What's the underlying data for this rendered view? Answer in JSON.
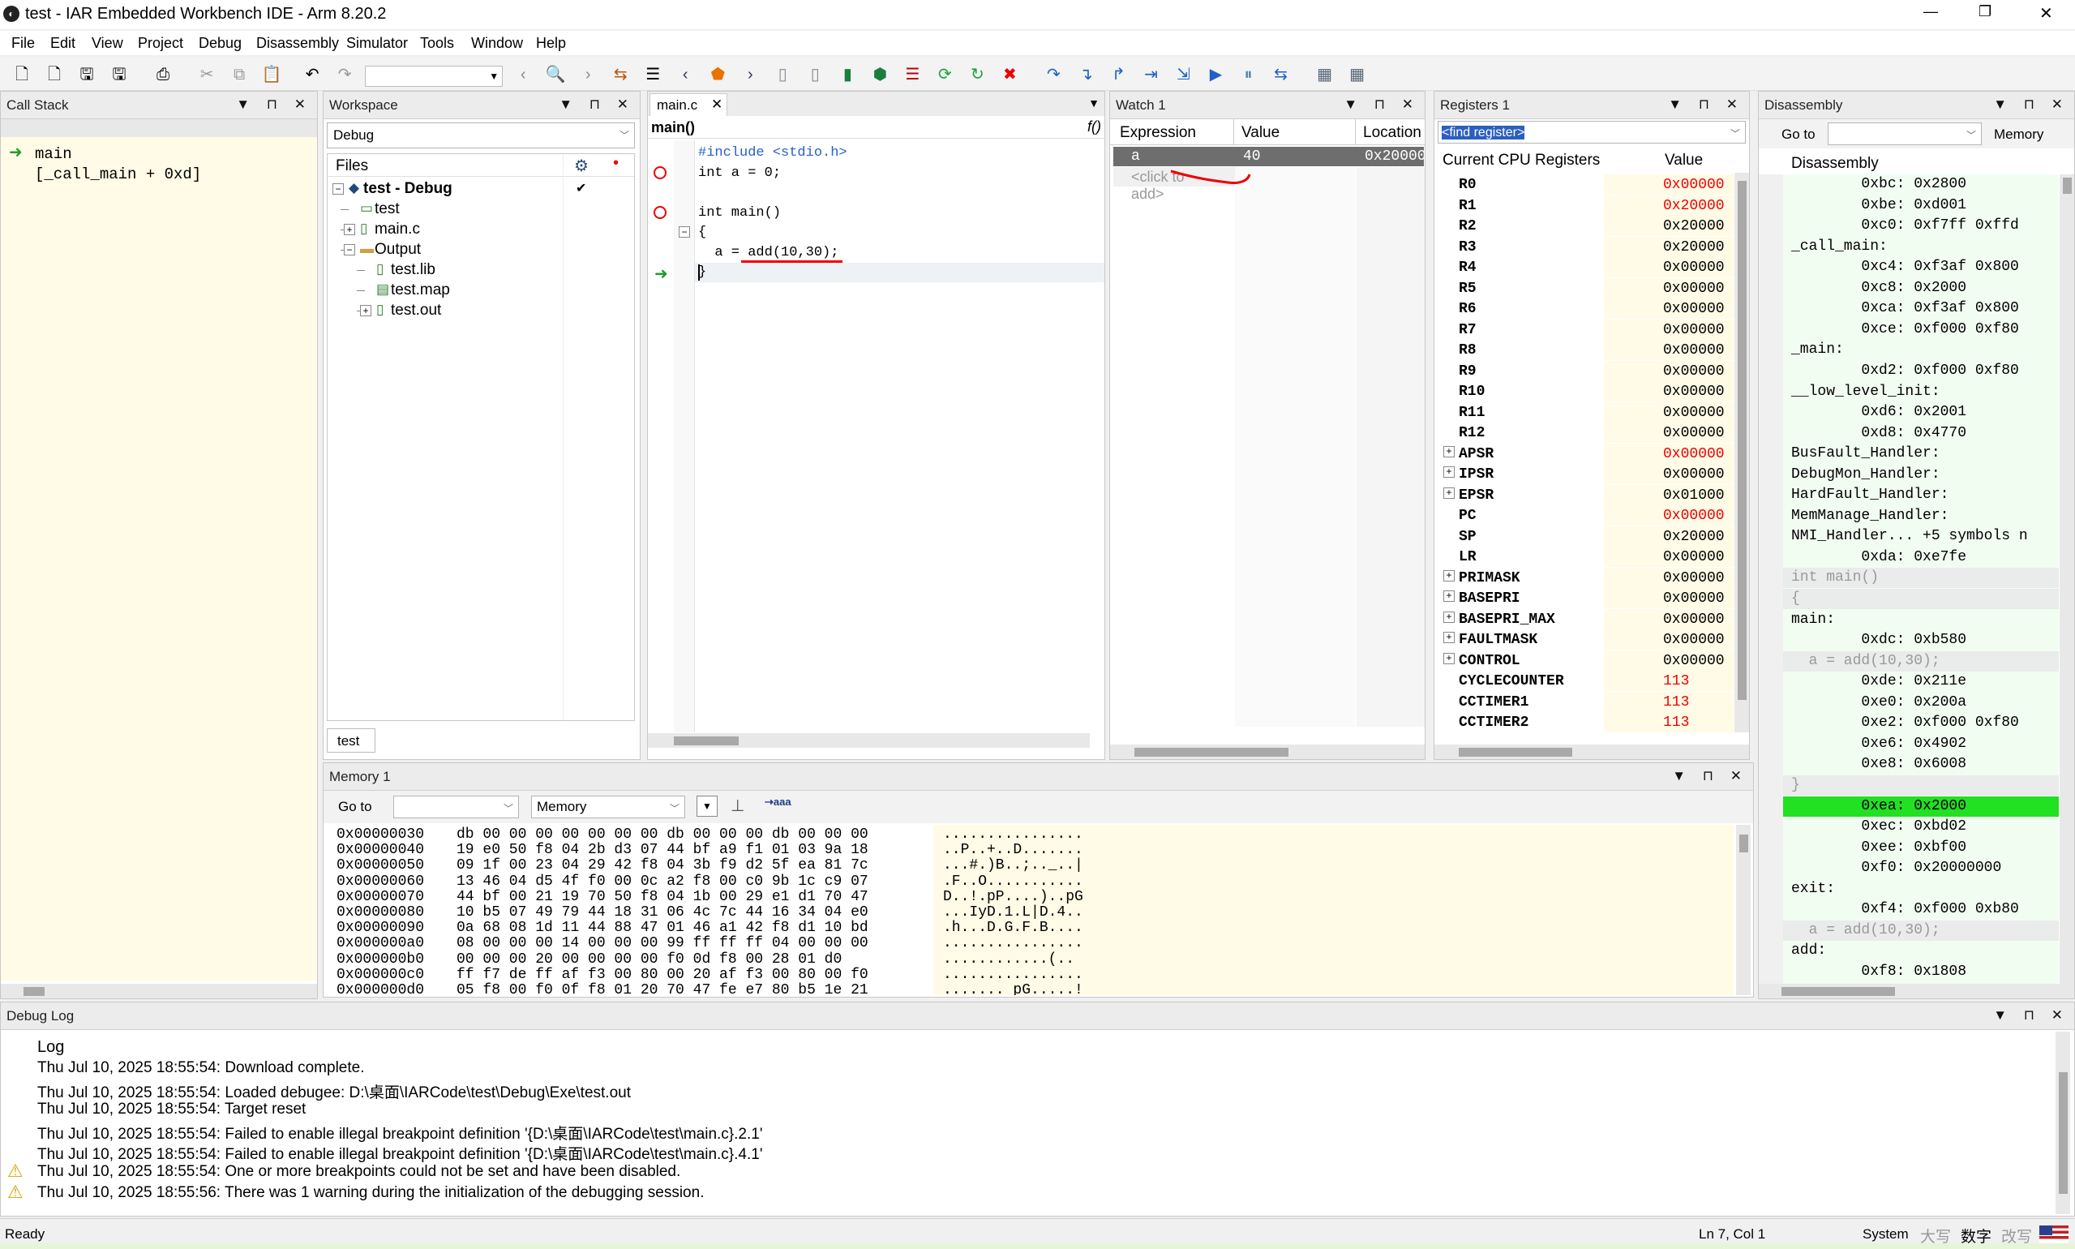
{
  "window": {
    "title": "test - IAR Embedded Workbench IDE - Arm 8.20.2",
    "controls": {
      "minimize": "—",
      "maximize": "❐",
      "close": "✕"
    }
  },
  "menu": [
    "File",
    "Edit",
    "View",
    "Project",
    "Debug",
    "Disassembly",
    "Simulator",
    "Tools",
    "Window",
    "Help"
  ],
  "callstack": {
    "title": "Call Stack",
    "frames": [
      "main",
      "[_call_main + 0xd]"
    ]
  },
  "workspace": {
    "title": "Workspace",
    "config": "Debug",
    "files_header": "Files",
    "tree": [
      {
        "label": "test - Debug",
        "level": 0,
        "expand": "−",
        "icon": "◆",
        "check": "✔"
      },
      {
        "label": "test",
        "level": 1,
        "expand": "",
        "icon": "▭"
      },
      {
        "label": "main.c",
        "level": 1,
        "expand": "+",
        "icon": "▯"
      },
      {
        "label": "Output",
        "level": 1,
        "expand": "−",
        "icon": "▬"
      },
      {
        "label": "test.lib",
        "level": 2,
        "expand": "",
        "icon": "▯"
      },
      {
        "label": "test.map",
        "level": 2,
        "expand": "",
        "icon": "▤"
      },
      {
        "label": "test.out",
        "level": 2,
        "expand": "+",
        "icon": "▯"
      }
    ],
    "tab": "test"
  },
  "editor": {
    "tab": "main.c",
    "function": "main()",
    "fbutton": "f()",
    "lines": [
      {
        "code": "#include <stdio.h>",
        "bp": false
      },
      {
        "code": "int a = 0;",
        "bp": true
      },
      {
        "code": "",
        "bp": false
      },
      {
        "code": "int main()",
        "bp": true
      },
      {
        "code": "{",
        "bp": false
      },
      {
        "code": "  a = add(10,30);",
        "bp": false
      },
      {
        "code": "}",
        "bp": false
      }
    ]
  },
  "watch": {
    "title": "Watch 1",
    "columns": [
      "Expression",
      "Value",
      "Location"
    ],
    "rows": [
      {
        "expr": "a",
        "value": "40",
        "loc": "0x20000"
      }
    ],
    "placeholder": "<click to add>"
  },
  "registers": {
    "title": "Registers 1",
    "find": "<find register>",
    "group_header": "Current CPU Registers",
    "value_header": "Value",
    "regs": [
      {
        "name": "R0",
        "value": "0x00000",
        "red": true,
        "expand": false
      },
      {
        "name": "R1",
        "value": "0x20000",
        "red": true,
        "expand": false
      },
      {
        "name": "R2",
        "value": "0x20000",
        "red": false,
        "expand": false
      },
      {
        "name": "R3",
        "value": "0x20000",
        "red": false,
        "expand": false
      },
      {
        "name": "R4",
        "value": "0x00000",
        "red": false,
        "expand": false
      },
      {
        "name": "R5",
        "value": "0x00000",
        "red": false,
        "expand": false
      },
      {
        "name": "R6",
        "value": "0x00000",
        "red": false,
        "expand": false
      },
      {
        "name": "R7",
        "value": "0x00000",
        "red": false,
        "expand": false
      },
      {
        "name": "R8",
        "value": "0x00000",
        "red": false,
        "expand": false
      },
      {
        "name": "R9",
        "value": "0x00000",
        "red": false,
        "expand": false
      },
      {
        "name": "R10",
        "value": "0x00000",
        "red": false,
        "expand": false
      },
      {
        "name": "R11",
        "value": "0x00000",
        "red": false,
        "expand": false
      },
      {
        "name": "R12",
        "value": "0x00000",
        "red": false,
        "expand": false
      },
      {
        "name": "APSR",
        "value": "0x00000",
        "red": true,
        "expand": true
      },
      {
        "name": "IPSR",
        "value": "0x00000",
        "red": false,
        "expand": true
      },
      {
        "name": "EPSR",
        "value": "0x01000",
        "red": false,
        "expand": true
      },
      {
        "name": "PC",
        "value": "0x00000",
        "red": true,
        "expand": false
      },
      {
        "name": "SP",
        "value": "0x20000",
        "red": false,
        "expand": false
      },
      {
        "name": "LR",
        "value": "0x00000",
        "red": false,
        "expand": false
      },
      {
        "name": "PRIMASK",
        "value": "0x00000",
        "red": false,
        "expand": true
      },
      {
        "name": "BASEPRI",
        "value": "0x00000",
        "red": false,
        "expand": true
      },
      {
        "name": "BASEPRI_MAX",
        "value": "0x00000",
        "red": false,
        "expand": true
      },
      {
        "name": "FAULTMASK",
        "value": "0x00000",
        "red": false,
        "expand": true
      },
      {
        "name": "CONTROL",
        "value": "0x00000",
        "red": false,
        "expand": true
      },
      {
        "name": "CYCLECOUNTER",
        "value": "113",
        "red": true,
        "expand": false
      },
      {
        "name": "CCTIMER1",
        "value": "113",
        "red": true,
        "expand": false
      },
      {
        "name": "CCTIMER2",
        "value": "113",
        "red": true,
        "expand": false
      }
    ]
  },
  "disasm": {
    "title": "Disassembly",
    "goto": "Go to",
    "memory": "Memory",
    "header": "Disassembly",
    "lines": [
      {
        "t": "        0xbc: 0x2800",
        "k": "code"
      },
      {
        "t": "        0xbe: 0xd001",
        "k": "code"
      },
      {
        "t": "        0xc0: 0xf7ff 0xffd",
        "k": "code"
      },
      {
        "t": "_call_main:",
        "k": "label"
      },
      {
        "t": "        0xc4: 0xf3af 0x800",
        "k": "code"
      },
      {
        "t": "        0xc8: 0x2000",
        "k": "code"
      },
      {
        "t": "        0xca: 0xf3af 0x800",
        "k": "code"
      },
      {
        "t": "        0xce: 0xf000 0xf80",
        "k": "code"
      },
      {
        "t": "_main:",
        "k": "label"
      },
      {
        "t": "        0xd2: 0xf000 0xf80",
        "k": "code"
      },
      {
        "t": "__low_level_init:",
        "k": "label"
      },
      {
        "t": "        0xd6: 0x2001",
        "k": "code"
      },
      {
        "t": "        0xd8: 0x4770",
        "k": "code"
      },
      {
        "t": "BusFault_Handler:",
        "k": "label"
      },
      {
        "t": "DebugMon_Handler:",
        "k": "label"
      },
      {
        "t": "HardFault_Handler:",
        "k": "label"
      },
      {
        "t": "MemManage_Handler:",
        "k": "label"
      },
      {
        "t": "NMI_Handler... +5 symbols n",
        "k": "label"
      },
      {
        "t": "        0xda: 0xe7fe",
        "k": "code"
      },
      {
        "t": "int main()",
        "k": "src"
      },
      {
        "t": "{",
        "k": "src"
      },
      {
        "t": "main:",
        "k": "label"
      },
      {
        "t": "        0xdc: 0xb580",
        "k": "code"
      },
      {
        "t": "  a = add(10,30);",
        "k": "src"
      },
      {
        "t": "        0xde: 0x211e",
        "k": "code"
      },
      {
        "t": "        0xe0: 0x200a",
        "k": "code"
      },
      {
        "t": "        0xe2: 0xf000 0xf80",
        "k": "code"
      },
      {
        "t": "        0xe6: 0x4902",
        "k": "code"
      },
      {
        "t": "        0xe8: 0x6008",
        "k": "code"
      },
      {
        "t": "}",
        "k": "src"
      },
      {
        "t": "        0xea: 0x2000",
        "k": "hl"
      },
      {
        "t": "        0xec: 0xbd02",
        "k": "code"
      },
      {
        "t": "        0xee: 0xbf00",
        "k": "code"
      },
      {
        "t": "        0xf0: 0x20000000",
        "k": "code"
      },
      {
        "t": "exit:",
        "k": "label"
      },
      {
        "t": "        0xf4: 0xf000 0xb80",
        "k": "code"
      },
      {
        "t": "  a = add(10,30);",
        "k": "src"
      },
      {
        "t": "add:",
        "k": "label"
      },
      {
        "t": "        0xf8: 0x1808",
        "k": "code"
      }
    ]
  },
  "memory": {
    "title": "Memory 1",
    "goto": "Go to",
    "zone": "Memory",
    "rows": [
      {
        "addr": "0x00000030",
        "hex": "db 00 00 00 00 00 00 00 db 00 00 00 db 00 00 00",
        "ascii": "................"
      },
      {
        "addr": "0x00000040",
        "hex": "19 e0 50 f8 04 2b d3 07 44 bf a9 f1 01 03 9a 18",
        "ascii": "..P..+..D......."
      },
      {
        "addr": "0x00000050",
        "hex": "09 1f 00 23 04 29 42 f8 04 3b f9 d2 5f ea 81 7c",
        "ascii": "...#.)B..;.._..|"
      },
      {
        "addr": "0x00000060",
        "hex": "13 46 04 d5 4f f0 00 0c a2 f8 00 c0 9b 1c c9 07",
        "ascii": ".F..O..........."
      },
      {
        "addr": "0x00000070",
        "hex": "44 bf 00 21 19 70 50 f8 04 1b 00 29 e1 d1 70 47",
        "ascii": "D..!.pP....)..pG"
      },
      {
        "addr": "0x00000080",
        "hex": "10 b5 07 49 79 44 18 31 06 4c 7c 44 16 34 04 e0",
        "ascii": "...IyD.1.L|D.4.."
      },
      {
        "addr": "0x00000090",
        "hex": "0a 68 08 1d 11 44 88 47 01 46 a1 42 f8 d1 10 bd",
        "ascii": ".h...D.G.F.B...."
      },
      {
        "addr": "0x000000a0",
        "hex": "08 00 00 00 14 00 00 00 99 ff ff ff 04 00 00 00",
        "ascii": "................"
      },
      {
        "addr": "0x000000b0",
        "hex": "00 00 00 20 00 00 00 00 f0 0d f8 00 28 01 d0",
        "ascii": "............(.."
      },
      {
        "addr": "0x000000c0",
        "hex": "ff f7 de ff af f3 00 80 00 20 af f3 00 80 00 f0",
        "ascii": "................"
      },
      {
        "addr": "0x000000d0",
        "hex": "05 f8 00 f0 0f f8 01 20 70 47 fe e7 80 b5 1e 21",
        "ascii": "....... pG.....!"
      }
    ]
  },
  "log": {
    "title": "Debug Log",
    "header": "Log",
    "entries": [
      {
        "text": "Thu Jul 10, 2025 18:55:54: Download complete.",
        "warn": false
      },
      {
        "text": "Thu Jul 10, 2025 18:55:54: Loaded debugee: D:\\桌面\\IARCode\\test\\Debug\\Exe\\test.out",
        "warn": false
      },
      {
        "text": "Thu Jul 10, 2025 18:55:54: Target reset",
        "warn": false
      },
      {
        "text": "Thu Jul 10, 2025 18:55:54: Failed to enable illegal breakpoint definition '{D:\\桌面\\IARCode\\test\\main.c}.2.1'",
        "warn": false
      },
      {
        "text": "Thu Jul 10, 2025 18:55:54: Failed to enable illegal breakpoint definition '{D:\\桌面\\IARCode\\test\\main.c}.4.1'",
        "warn": false
      },
      {
        "text": "Thu Jul 10, 2025 18:55:54: One or more breakpoints could not be set and have been disabled.",
        "warn": true
      },
      {
        "text": "Thu Jul 10, 2025 18:55:56: There was 1 warning during the initialization of the debugging session.",
        "warn": true
      }
    ]
  },
  "status": {
    "left": "Ready",
    "pos": "Ln 7, Col 1",
    "mode": "System",
    "ind1": "大写",
    "ind2": "数字",
    "ind3": "改写"
  }
}
